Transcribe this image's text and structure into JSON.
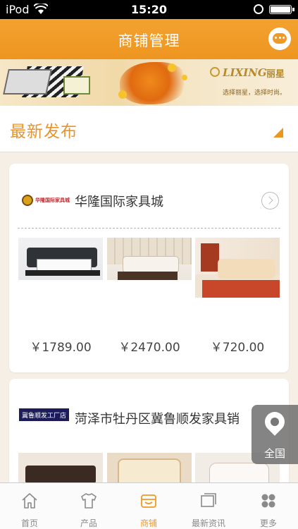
{
  "status_bar": {
    "carrier": "iPod",
    "time": "15:20"
  },
  "nav": {
    "title": "商铺管理",
    "chat_icon": "chat-bubble-icon",
    "accent": "#ef9a24"
  },
  "banner": {
    "brand": "LIXING",
    "brand_cn": "丽星",
    "slogan": "选择丽星，选择时尚。"
  },
  "section": {
    "title": "最新发布"
  },
  "stores": [
    {
      "logo_text": "华隆国际家具城",
      "name": "华隆国际家具城",
      "products": [
        {
          "price": "￥1789.00"
        },
        {
          "price": "￥2470.00"
        },
        {
          "price": "￥720.00"
        }
      ]
    },
    {
      "logo_text": "冀鲁顺发工厂店",
      "name": "菏泽市牡丹区冀鲁顺发家具销"
    }
  ],
  "region_button": {
    "label": "全国",
    "icon": "location-pin-icon"
  },
  "tabs": [
    {
      "label": "首页",
      "icon": "home-icon",
      "active": false
    },
    {
      "label": "产品",
      "icon": "shirt-icon",
      "active": false
    },
    {
      "label": "商铺",
      "icon": "shop-icon",
      "active": true
    },
    {
      "label": "最新资讯",
      "icon": "news-icon",
      "active": false
    },
    {
      "label": "更多",
      "icon": "more-grid-icon",
      "active": false
    }
  ]
}
